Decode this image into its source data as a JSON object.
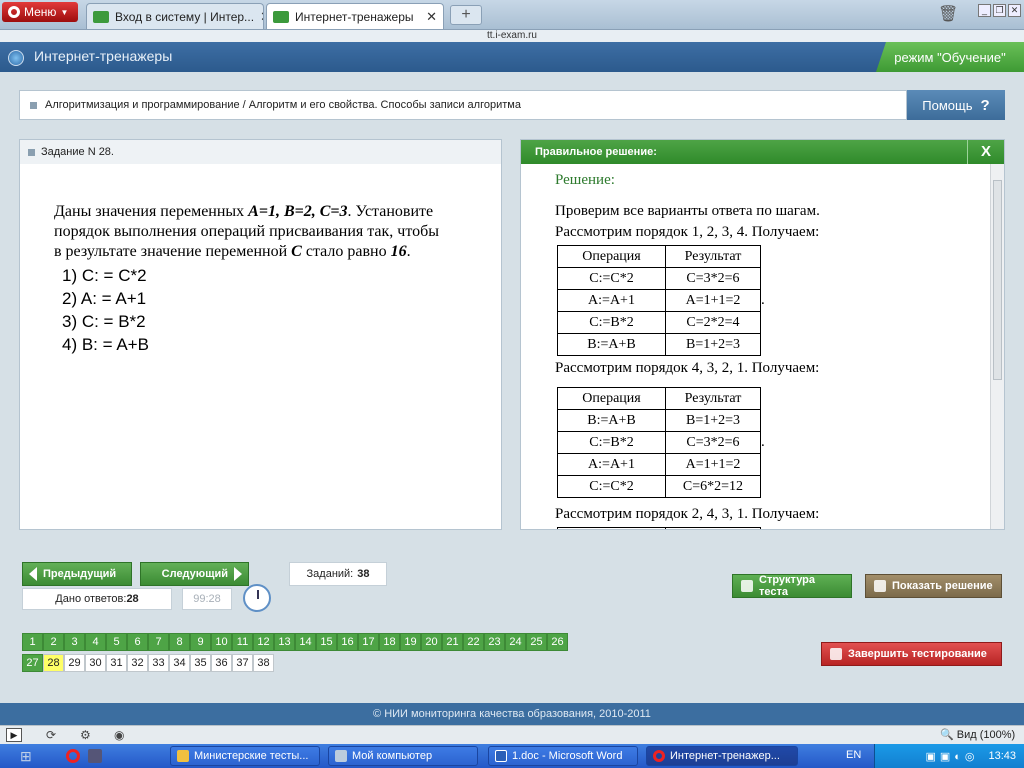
{
  "browser": {
    "menu_label": "Меню",
    "tabs": [
      {
        "title": "Вход в систему | Интер..."
      },
      {
        "title": "Интернет-тренажеры"
      }
    ],
    "new_tab": "+",
    "url": "tt.i-exam.ru"
  },
  "app": {
    "title": "Интернет-тренажеры",
    "mode": "режим \"Обучение\""
  },
  "breadcrumb": "Алгоритмизация и программирование / Алгоритм и его свойства. Способы записи алгоритма",
  "help_label": "Помощь",
  "task": {
    "header": "Задание N 28.",
    "text_1": "Даны значения переменных ",
    "vars": "A=1, B=2, C=3",
    "text_2": ". Установите порядок выполнения операций присваивания так, чтобы в результате значение переменной ",
    "var_c": "C",
    "text_3": " стало равно ",
    "target": "16",
    "text_4": ".",
    "options": [
      "1) C: = C*2",
      "2) A: = A+1",
      "3) C: = B*2",
      "4) B: = A+B"
    ]
  },
  "solution": {
    "header": "Правильное решение:",
    "close": "X",
    "heading": "Решение:",
    "intro": "Проверим все варианты ответа по шагам.",
    "col_op": "Операция",
    "col_res": "Результат",
    "blocks": [
      {
        "title": "Рассмотрим порядок 1, 2, 3, 4. Получаем:",
        "rows": [
          [
            "C:=C*2",
            "C=3*2=6"
          ],
          [
            "A:=A+1",
            "A=1+1=2"
          ],
          [
            "C:=B*2",
            "C=2*2=4"
          ],
          [
            "B:=A+B",
            "B=1+2=3"
          ]
        ]
      },
      {
        "title": "Рассмотрим порядок  4, 3, 2, 1. Получаем:",
        "rows": [
          [
            "B:=A+B",
            "B=1+2=3"
          ],
          [
            "C:=B*2",
            "C=3*2=6"
          ],
          [
            "A:=A+1",
            "A=1+1=2"
          ],
          [
            "C:=C*2",
            "C=6*2=12"
          ]
        ]
      },
      {
        "title": "Рассмотрим порядок  2, 4, 3, 1. Получаем:",
        "rows": []
      }
    ],
    "dot": "."
  },
  "controls": {
    "prev": "Предыдущий",
    "next": "Следующий",
    "tasks_label": "Заданий:",
    "tasks_count": "38",
    "answered_label": "Дано ответов:",
    "answered_count": "28",
    "timer": "99:28",
    "structure": "Структура теста",
    "show_solution": "Показать решение",
    "finish": "Завершить тестирование"
  },
  "task_numbers": {
    "answered": [
      "1",
      "2",
      "3",
      "4",
      "5",
      "6",
      "7",
      "8",
      "9",
      "10",
      "11",
      "12",
      "13",
      "14",
      "15",
      "16",
      "17",
      "18",
      "19",
      "20",
      "21",
      "22",
      "23",
      "24",
      "25",
      "26",
      "27"
    ],
    "current": "28",
    "unanswered": [
      "29",
      "30",
      "31",
      "32",
      "33",
      "34",
      "35",
      "36",
      "37",
      "38"
    ]
  },
  "copyright": "© НИИ мониторинга качества образования, 2010-2011",
  "statusbar": {
    "zoom": "Вид (100%)"
  },
  "taskbar": {
    "items": [
      {
        "label": "Министерские тесты..."
      },
      {
        "label": "Мой компьютер"
      },
      {
        "label": "1.doc - Microsoft Word"
      },
      {
        "label": "Интернет-тренажер..."
      }
    ],
    "lang": "EN",
    "time": "13:43"
  },
  "colors": {
    "accent_green": "#4ea446",
    "header_blue": "#2c5a8d",
    "current_task": "#ffff66",
    "finish_red": "#c83030"
  }
}
